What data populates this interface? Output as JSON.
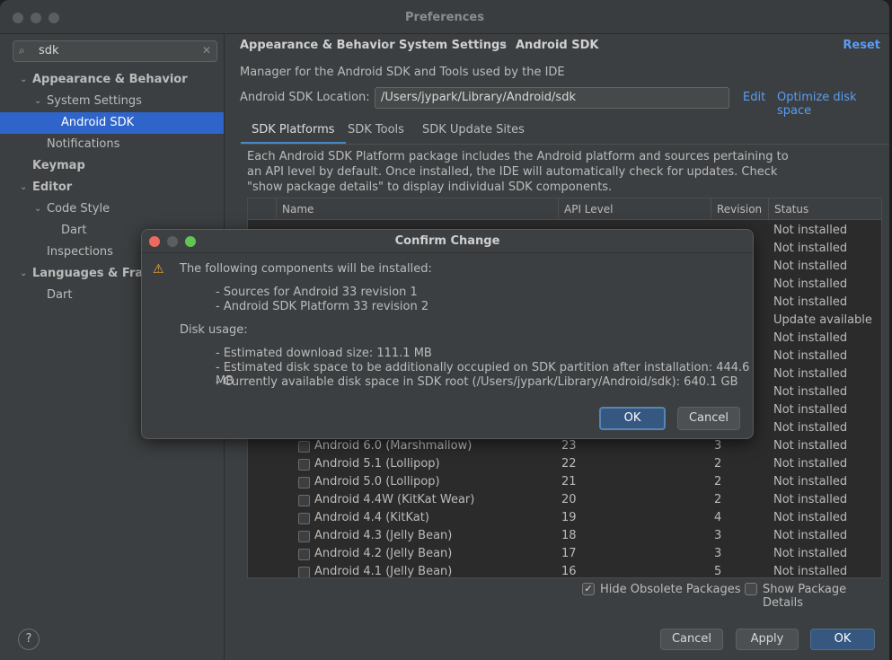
{
  "window": {
    "title": "Preferences"
  },
  "sidebar": {
    "search_value": "sdk",
    "items": [
      {
        "label": "Appearance & Behavior",
        "arrow": "⌄"
      },
      {
        "label": "System Settings",
        "arrow": "⌄"
      },
      {
        "label": "Android SDK",
        "arrow": ""
      },
      {
        "label": "Notifications",
        "arrow": ""
      },
      {
        "label": "Keymap",
        "arrow": ""
      },
      {
        "label": "Editor",
        "arrow": "⌄"
      },
      {
        "label": "Code Style",
        "arrow": "⌄"
      },
      {
        "label": "Dart",
        "arrow": ""
      },
      {
        "label": "Inspections",
        "arrow": ""
      },
      {
        "label": "Languages & Frameworks",
        "arrow": "⌄"
      },
      {
        "label": "Dart",
        "arrow": ""
      }
    ],
    "help": "?"
  },
  "breadcrumb": {
    "items": [
      "Appearance & Behavior",
      "System Settings",
      "Android SDK"
    ],
    "separator": "›",
    "reset": "Reset"
  },
  "main": {
    "description": "Manager for the Android SDK and Tools used by the IDE",
    "location_label": "Android SDK Location:",
    "location_value": "/Users/jypark/Library/Android/sdk",
    "edit": "Edit",
    "optimize": "Optimize disk space",
    "tabs": [
      "SDK Platforms",
      "SDK Tools",
      "SDK Update Sites"
    ],
    "package_description": "Each Android SDK Platform package includes the Android platform and sources pertaining to an API level by default. Once installed, the IDE will automatically check for updates. Check \"show package details\" to display individual SDK components."
  },
  "table": {
    "headers": [
      "Name",
      "API Level",
      "Revision",
      "Status"
    ],
    "rows": [
      {
        "name": "",
        "api": "",
        "rev": "",
        "status": "Not installed"
      },
      {
        "name": "",
        "api": "",
        "rev": "",
        "status": "Not installed"
      },
      {
        "name": "",
        "api": "",
        "rev": "",
        "status": "Not installed"
      },
      {
        "name": "",
        "api": "",
        "rev": "",
        "status": "Not installed"
      },
      {
        "name": "",
        "api": "",
        "rev": "",
        "status": "Not installed"
      },
      {
        "name": "",
        "api": "",
        "rev": "",
        "status": "Update available"
      },
      {
        "name": "",
        "api": "",
        "rev": "",
        "status": "Not installed"
      },
      {
        "name": "",
        "api": "",
        "rev": "",
        "status": "Not installed"
      },
      {
        "name": "",
        "api": "",
        "rev": "",
        "status": "Not installed"
      },
      {
        "name": "",
        "api": "",
        "rev": "",
        "status": "Not installed"
      },
      {
        "name": "",
        "api": "",
        "rev": "",
        "status": "Not installed"
      },
      {
        "name": "",
        "api": "",
        "rev": "",
        "status": "Not installed"
      },
      {
        "name": "Android 6.0 (Marshmallow)",
        "api": "23",
        "rev": "3",
        "status": "Not installed"
      },
      {
        "name": "Android 5.1 (Lollipop)",
        "api": "22",
        "rev": "2",
        "status": "Not installed"
      },
      {
        "name": "Android 5.0 (Lollipop)",
        "api": "21",
        "rev": "2",
        "status": "Not installed"
      },
      {
        "name": "Android 4.4W (KitKat Wear)",
        "api": "20",
        "rev": "2",
        "status": "Not installed"
      },
      {
        "name": "Android 4.4 (KitKat)",
        "api": "19",
        "rev": "4",
        "status": "Not installed"
      },
      {
        "name": "Android 4.3 (Jelly Bean)",
        "api": "18",
        "rev": "3",
        "status": "Not installed"
      },
      {
        "name": "Android 4.2 (Jelly Bean)",
        "api": "17",
        "rev": "3",
        "status": "Not installed"
      },
      {
        "name": "Android 4.1 (Jelly Bean)",
        "api": "16",
        "rev": "5",
        "status": "Not installed"
      }
    ]
  },
  "footer": {
    "hide_obsolete": "Hide Obsolete Packages",
    "hide_obsolete_checked": "✓",
    "show_details": "Show Package Details",
    "cancel": "Cancel",
    "apply": "Apply",
    "ok": "OK"
  },
  "dialog": {
    "title": "Confirm Change",
    "heading": "The following components will be installed:",
    "components": [
      "- Sources for Android 33 revision 1",
      "- Android SDK Platform 33 revision 2"
    ],
    "disk_usage_label": "Disk usage:",
    "disk_lines": [
      "- Estimated download size: 111.1 MB",
      "- Estimated disk space to be additionally occupied on SDK partition after installation: 444.6 MB",
      "- Currently available disk space in SDK root (/Users/jypark/Library/Android/sdk): 640.1 GB"
    ],
    "ok": "OK",
    "cancel": "Cancel",
    "warning_icon": "⚠",
    "colors": {
      "close": "#ed6a5e",
      "minimize": "#5b5e61",
      "zoom": "#61c554"
    }
  }
}
